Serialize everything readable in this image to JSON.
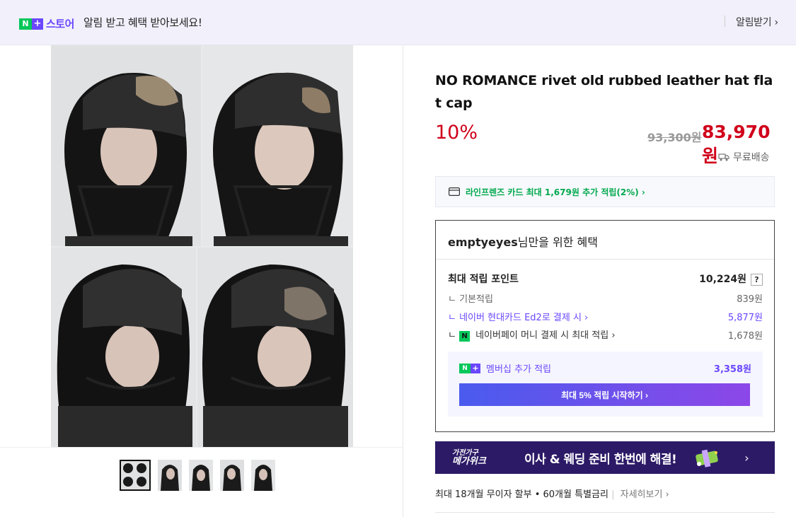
{
  "topbar": {
    "logo_n": "N",
    "logo_plus": "+",
    "logo_store": "스토어",
    "message": "알림 받고 혜택 받아보세요!",
    "notify_label": "알림받기 ›"
  },
  "product": {
    "title": "NO ROMANCE rivet old rubbed leather hat flat cap",
    "discount": "10%",
    "original_price": "93,300원",
    "sale_price": "83,970원",
    "delivery": "무료배송"
  },
  "gallery": {
    "thumbnails": [
      "thumb-1",
      "thumb-2",
      "thumb-3",
      "thumb-4",
      "thumb-5"
    ],
    "active_index": 0
  },
  "card_promo": {
    "text": "라인프렌즈 카드 최대 1,679원 추가 적립(2%) ›"
  },
  "benefit": {
    "user": "emptyeyes",
    "header_suffix": "님만을 위한 혜택",
    "max_points_label": "최대 적립 포인트",
    "max_points_value": "10,224원",
    "help": "?",
    "rows": [
      {
        "label": "기본적립",
        "value": "839원"
      },
      {
        "label": "네이버 현대카드 Ed2로 결제 시 ›",
        "value": "5,877원"
      },
      {
        "label": "네이버페이 머니 결제 시 최대 적립 ›",
        "value": "1,678원",
        "badge": "N"
      }
    ],
    "membership_label": "멤버십 추가 적립",
    "membership_value": "3,358원",
    "cta_label": "최대 5% 적립 시작하기 ›"
  },
  "banner": {
    "logo_line1": "가전가구",
    "logo_line2": "메가위크",
    "text": "이사 & 웨딩 준비 한번에 해결!",
    "arrow": "›"
  },
  "installment": {
    "text": "최대 18개월 무이자 할부 • 60개월 특별금리",
    "more": "자세히보기 ›"
  },
  "colors": {
    "accent_purple": "#6b47ff",
    "naver_green": "#03c75a",
    "price_red": "#d0011b",
    "banner_navy": "#2c1a67"
  }
}
